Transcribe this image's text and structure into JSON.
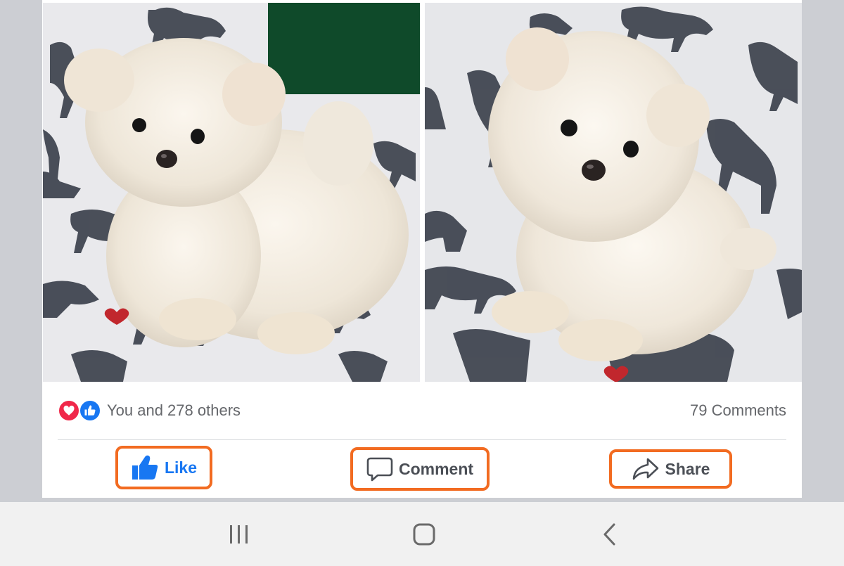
{
  "post": {
    "photos": [
      {
        "name": "white-puppy-photo-left",
        "description_icon": "puppy-photo"
      },
      {
        "name": "white-puppy-photo-right",
        "description_icon": "puppy-photo"
      }
    ],
    "reactions": {
      "icons": [
        "heart-icon",
        "thumbs-up-icon"
      ],
      "summary_text": "You and 278 others"
    },
    "comments_count_text": "79 Comments",
    "actions": {
      "like_label": "Like",
      "comment_label": "Comment",
      "share_label": "Share"
    },
    "colors": {
      "like_active": "#1877f2",
      "heart": "#f0284a",
      "highlight_border": "#f26b21",
      "secondary_text": "#65676b"
    }
  },
  "navbar": {
    "buttons": [
      "recent-apps-icon",
      "home-icon",
      "back-icon"
    ]
  }
}
